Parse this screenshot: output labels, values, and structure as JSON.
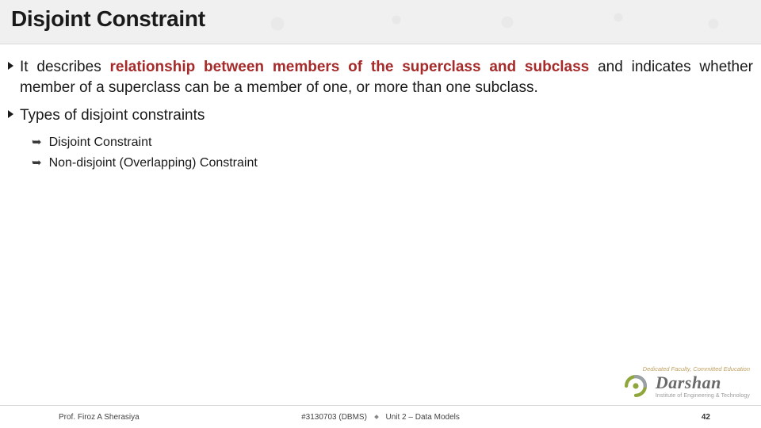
{
  "title": "Disjoint Constraint",
  "bullets": {
    "b1": {
      "pre": "It describes ",
      "boldRed": "relationship between members of the superclass and subclass",
      "post": " and indicates whether member of a superclass can be a member of one, or more than one subclass."
    },
    "b2": "Types of disjoint constraints",
    "sub1": "Disjoint Constraint",
    "sub2": "Non-disjoint (Overlapping) Constraint"
  },
  "footer": {
    "professor": "Prof. Firoz A Sherasiya",
    "course": "#3130703 (DBMS)",
    "unit": "Unit 2 – Data Models",
    "page": "42"
  },
  "logo": {
    "name": "Darshan",
    "subtitle": "Institute of Engineering & Technology",
    "tagline": "Dedicated Faculty, Committed Education"
  }
}
